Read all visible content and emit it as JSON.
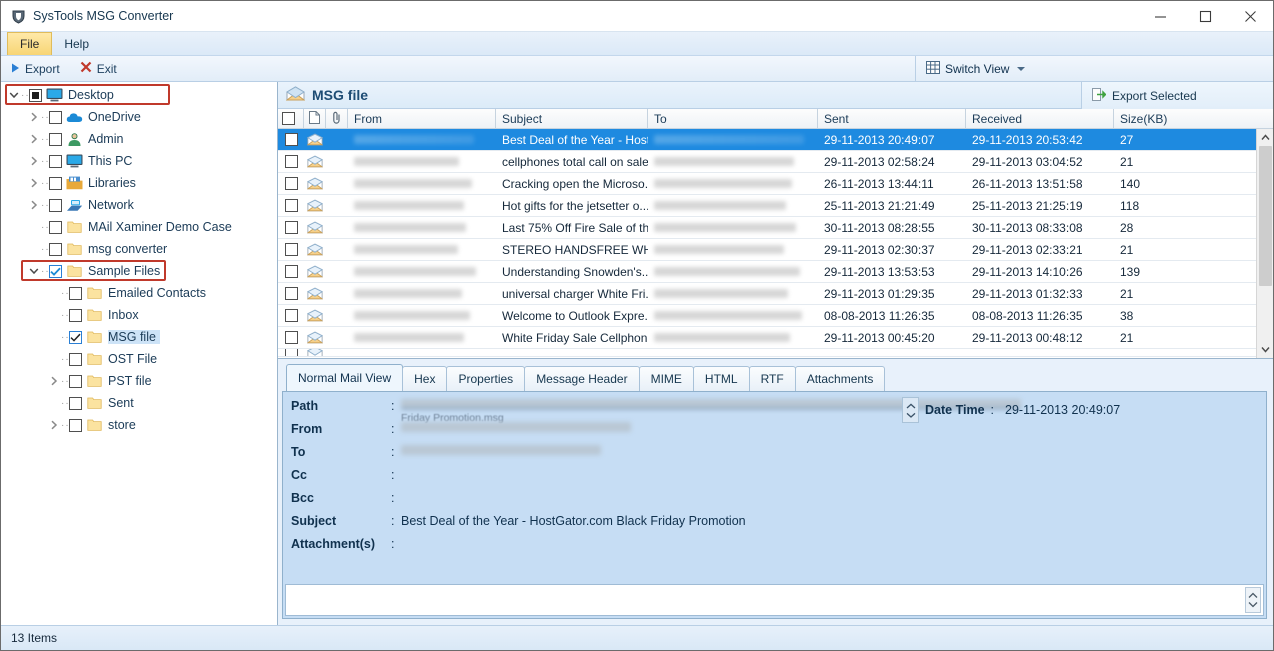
{
  "window": {
    "title": "SysTools MSG Converter",
    "app_icon": "shield-icon",
    "minimize_label": "—",
    "maximize_label": "□",
    "close_label": "✕"
  },
  "menu": {
    "items": [
      {
        "label": "File",
        "active": true
      },
      {
        "label": "Help",
        "active": false
      }
    ]
  },
  "toolbar": {
    "export_label": "Export",
    "exit_label": "Exit",
    "switch_view_label": "Switch View"
  },
  "tree": {
    "items": [
      {
        "label": "Desktop",
        "indent": 0,
        "twisty": "down",
        "checkbox": "partial",
        "icon": "monitor-icon",
        "highlight": true,
        "selected": false
      },
      {
        "label": "OneDrive",
        "indent": 1,
        "twisty": "right",
        "checkbox": "none",
        "icon": "cloud-icon",
        "highlight": false,
        "selected": false
      },
      {
        "label": "Admin",
        "indent": 1,
        "twisty": "right",
        "checkbox": "none",
        "icon": "user-icon",
        "highlight": false,
        "selected": false
      },
      {
        "label": "This PC",
        "indent": 1,
        "twisty": "right",
        "checkbox": "none",
        "icon": "monitor-icon",
        "highlight": false,
        "selected": false
      },
      {
        "label": "Libraries",
        "indent": 1,
        "twisty": "right",
        "checkbox": "none",
        "icon": "libraries-icon",
        "highlight": false,
        "selected": false
      },
      {
        "label": "Network",
        "indent": 1,
        "twisty": "right",
        "checkbox": "none",
        "icon": "network-icon",
        "highlight": false,
        "selected": false
      },
      {
        "label": "MAil Xaminer Demo Case",
        "indent": 1,
        "twisty": "none",
        "checkbox": "none",
        "icon": "folder-icon",
        "highlight": false,
        "selected": false
      },
      {
        "label": "msg converter",
        "indent": 1,
        "twisty": "none",
        "checkbox": "none",
        "icon": "folder-icon",
        "highlight": false,
        "selected": false
      },
      {
        "label": "Sample Files",
        "indent": 1,
        "twisty": "down",
        "checkbox": "checked",
        "icon": "folder-icon",
        "highlight": true,
        "selected": false
      },
      {
        "label": "Emailed Contacts",
        "indent": 2,
        "twisty": "none",
        "checkbox": "none",
        "icon": "folder-icon",
        "highlight": false,
        "selected": false
      },
      {
        "label": "Inbox",
        "indent": 2,
        "twisty": "none",
        "checkbox": "none",
        "icon": "folder-icon",
        "highlight": false,
        "selected": false
      },
      {
        "label": "MSG file",
        "indent": 2,
        "twisty": "none",
        "checkbox": "checked-plain",
        "icon": "folder-icon",
        "highlight": false,
        "selected": true
      },
      {
        "label": "OST File",
        "indent": 2,
        "twisty": "none",
        "checkbox": "none",
        "icon": "folder-icon",
        "highlight": false,
        "selected": false
      },
      {
        "label": "PST file",
        "indent": 2,
        "twisty": "right",
        "checkbox": "none",
        "icon": "folder-icon",
        "highlight": false,
        "selected": false
      },
      {
        "label": "Sent",
        "indent": 2,
        "twisty": "none",
        "checkbox": "none",
        "icon": "folder-icon",
        "highlight": false,
        "selected": false
      },
      {
        "label": "store",
        "indent": 2,
        "twisty": "right",
        "checkbox": "none",
        "icon": "folder-icon",
        "highlight": false,
        "selected": false
      }
    ]
  },
  "msg_panel": {
    "title": "MSG file",
    "icon": "envelope-icon",
    "export_selected_label": "Export Selected"
  },
  "list": {
    "columns": [
      "From",
      "Subject",
      "To",
      "Sent",
      "Received",
      "Size(KB)"
    ],
    "rows": [
      {
        "subject": "Best Deal of the Year - Host...",
        "sent": "29-11-2013 20:49:07",
        "received": "29-11-2013 20:53:42",
        "size": "27",
        "selected": true
      },
      {
        "subject": "cellphones total call on sale",
        "sent": "29-11-2013 02:58:24",
        "received": "29-11-2013 03:04:52",
        "size": "21",
        "selected": false
      },
      {
        "subject": "Cracking open the Microso...",
        "sent": "26-11-2013 13:44:11",
        "received": "26-11-2013 13:51:58",
        "size": "140",
        "selected": false
      },
      {
        "subject": "Hot gifts for the jetsetter o...",
        "sent": "25-11-2013 21:21:49",
        "received": "25-11-2013 21:25:19",
        "size": "118",
        "selected": false
      },
      {
        "subject": "Last 75% Off Fire Sale of th...",
        "sent": "30-11-2013 08:28:55",
        "received": "30-11-2013 08:33:08",
        "size": "28",
        "selected": false
      },
      {
        "subject": "STEREO HANDSFREE WHIT...",
        "sent": "29-11-2013 02:30:37",
        "received": "29-11-2013 02:33:21",
        "size": "21",
        "selected": false
      },
      {
        "subject": "Understanding Snowden's...",
        "sent": "29-11-2013 13:53:53",
        "received": "29-11-2013 14:10:26",
        "size": "139",
        "selected": false
      },
      {
        "subject": "universal charger White Fri...",
        "sent": "29-11-2013 01:29:35",
        "received": "29-11-2013 01:32:33",
        "size": "21",
        "selected": false
      },
      {
        "subject": "Welcome to Outlook Expre...",
        "sent": "08-08-2013 11:26:35",
        "received": "08-08-2013 11:26:35",
        "size": "38",
        "selected": false
      },
      {
        "subject": "White Friday Sale Cellphon...",
        "sent": "29-11-2013 00:45:20",
        "received": "29-11-2013 00:48:12",
        "size": "21",
        "selected": false
      }
    ]
  },
  "detail": {
    "tabs": [
      {
        "label": "Normal Mail View",
        "active": true
      },
      {
        "label": "Hex",
        "active": false
      },
      {
        "label": "Properties",
        "active": false
      },
      {
        "label": "Message Header",
        "active": false
      },
      {
        "label": "MIME",
        "active": false
      },
      {
        "label": "HTML",
        "active": false
      },
      {
        "label": "RTF",
        "active": false
      },
      {
        "label": "Attachments",
        "active": false
      }
    ],
    "fields": [
      {
        "key": "Path",
        "colon": ":",
        "value": ""
      },
      {
        "key": "From",
        "colon": ":",
        "value": ""
      },
      {
        "key": "To",
        "colon": ":",
        "value": ""
      },
      {
        "key": "Cc",
        "colon": ":",
        "value": ""
      },
      {
        "key": "Bcc",
        "colon": ":",
        "value": ""
      },
      {
        "key": "Subject",
        "colon": ":",
        "value": "Best Deal of the Year - HostGator.com Black Friday Promotion"
      },
      {
        "key": "Attachment(s)",
        "colon": ":",
        "value": ""
      }
    ],
    "path_ghost": "Friday Promotion.msg",
    "datetime_key": "Date Time",
    "datetime_colon": ":",
    "datetime_value": "29-11-2013 20:49:07"
  },
  "statusbar": {
    "items_label": "13 Items"
  },
  "colors": {
    "accent": "#1e8ae0",
    "highlight_red": "#c0392b",
    "menu_active": "#f7d575",
    "pane_blue": "#c6ddf4"
  }
}
